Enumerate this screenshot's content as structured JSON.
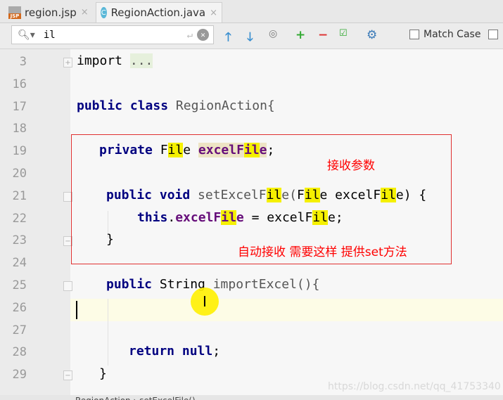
{
  "tabs": [
    {
      "label": "region.jsp",
      "icon": "jsp-file-icon",
      "close": "×"
    },
    {
      "label": "RegionAction.java",
      "icon": "java-class-icon",
      "icon_letter": "C",
      "close": "×",
      "active": true
    }
  ],
  "search": {
    "query": "il",
    "match_case_label": "Match Case"
  },
  "lines": [
    {
      "num": "3",
      "tokens": [
        {
          "t": "import ",
          "c": "kw-plain"
        },
        {
          "t": "...",
          "c": "fold-text"
        }
      ]
    },
    {
      "num": "16",
      "tokens": []
    },
    {
      "num": "17",
      "tokens": [
        {
          "t": "public class ",
          "c": "kw"
        },
        {
          "t": "RegionAction{",
          "c": "dim"
        }
      ]
    },
    {
      "num": "18",
      "tokens": []
    },
    {
      "num": "19",
      "tokens": [
        {
          "t": "private ",
          "c": "kw"
        },
        {
          "t": "F"
        },
        {
          "t": "il",
          "c": "hl"
        },
        {
          "t": "e "
        },
        {
          "t": "excelF",
          "c": "fd fhl"
        },
        {
          "t": "il",
          "c": "fd hl"
        },
        {
          "t": "e",
          "c": "fd fhl"
        },
        {
          "t": ";"
        }
      ]
    },
    {
      "num": "20",
      "tokens": []
    },
    {
      "num": "21",
      "tokens": [
        {
          "t": "public void ",
          "c": "kw"
        },
        {
          "t": "setExcelF",
          "c": "dim"
        },
        {
          "t": "il",
          "c": "hl"
        },
        {
          "t": "e(",
          "c": "dim"
        },
        {
          "t": "F"
        },
        {
          "t": "il",
          "c": "hl"
        },
        {
          "t": "e excelF"
        },
        {
          "t": "il",
          "c": "hl"
        },
        {
          "t": "e) {"
        }
      ]
    },
    {
      "num": "22",
      "tokens": [
        {
          "t": "this",
          "c": "kw"
        },
        {
          "t": "."
        },
        {
          "t": "excelF",
          "c": "fd"
        },
        {
          "t": "il",
          "c": "fd hl"
        },
        {
          "t": "e",
          "c": "fd"
        },
        {
          "t": " = excelF"
        },
        {
          "t": "il",
          "c": "hl"
        },
        {
          "t": "e;"
        }
      ]
    },
    {
      "num": "23",
      "tokens": [
        {
          "t": "}"
        }
      ]
    },
    {
      "num": "24",
      "tokens": []
    },
    {
      "num": "25",
      "tokens": [
        {
          "t": "public ",
          "c": "kw"
        },
        {
          "t": "String "
        },
        {
          "t": "importExcel(){",
          "c": "dim"
        }
      ]
    },
    {
      "num": "26",
      "tokens": []
    },
    {
      "num": "27",
      "tokens": []
    },
    {
      "num": "28",
      "tokens": [
        {
          "t": "return null",
          "c": "kw"
        },
        {
          "t": ";"
        }
      ]
    },
    {
      "num": "29",
      "tokens": [
        {
          "t": "}"
        }
      ]
    }
  ],
  "annotations": {
    "receive_params": "接收参数",
    "auto_receive": "自动接收 需要这样 提供set方法"
  },
  "watermark": "https://blog.csdn.net/qq_41753340",
  "breadcrumb": "RegionAction › setExcelFile()",
  "colors": {
    "highlight": "#f5f000",
    "annotation": "#ff0000",
    "keyword": "#000080"
  }
}
